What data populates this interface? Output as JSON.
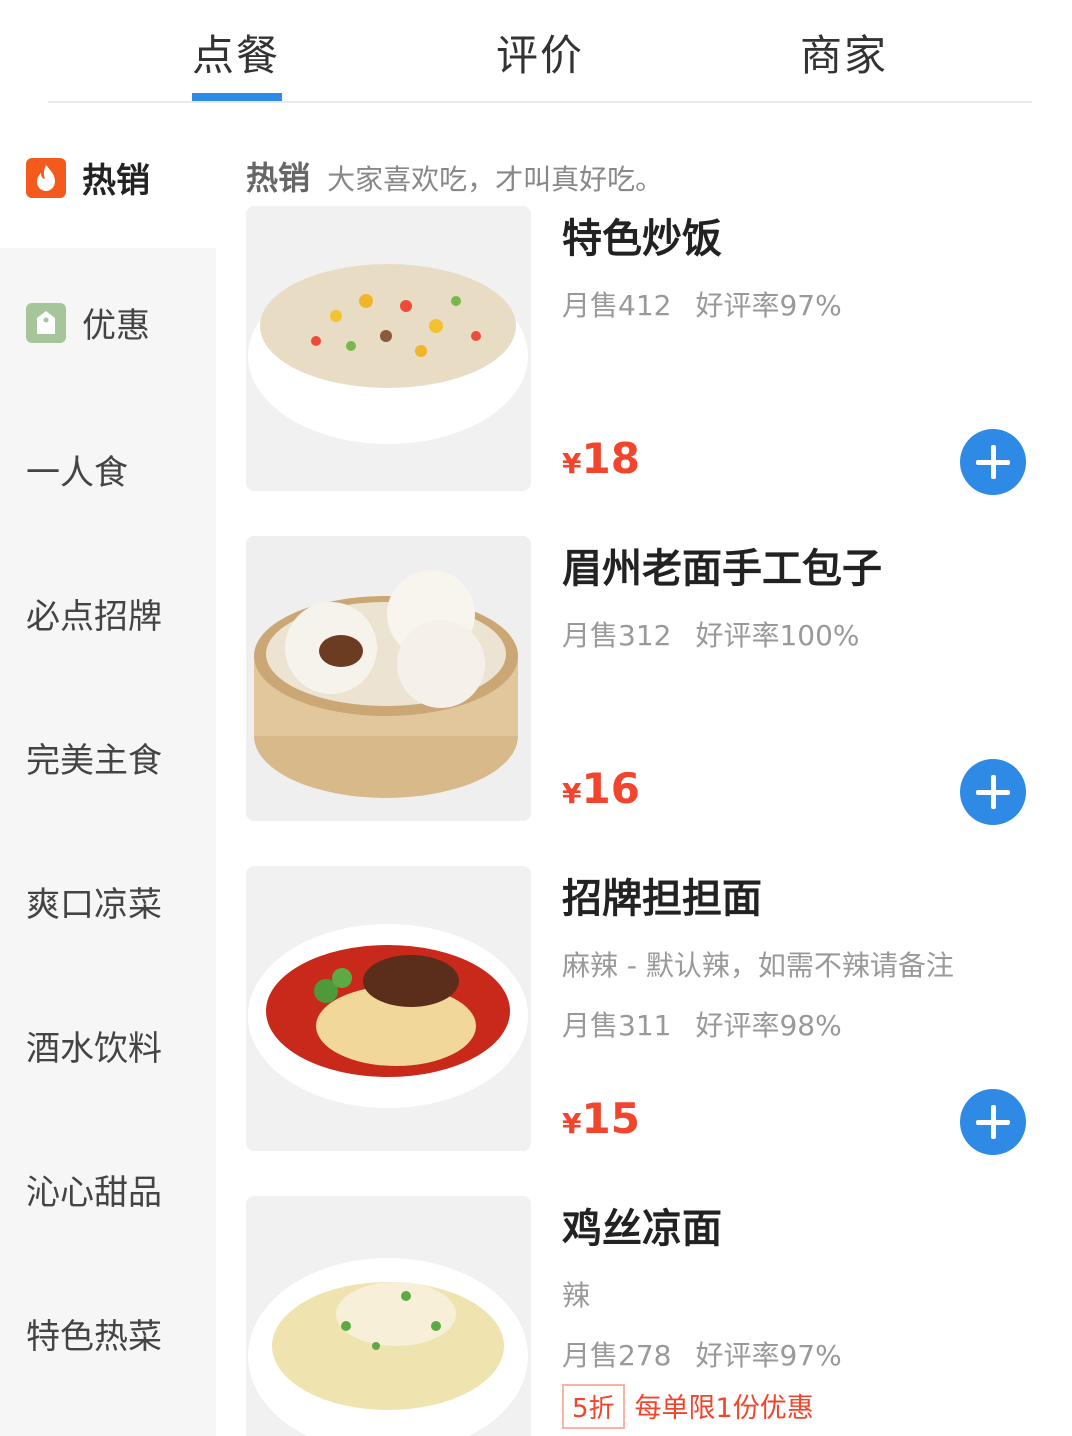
{
  "tabs": [
    {
      "label": "点餐"
    },
    {
      "label": "评价"
    },
    {
      "label": "商家"
    }
  ],
  "active_tab": "点餐",
  "accent_color": "#2f8ae6",
  "price_color": "#f1452d",
  "sidebar": {
    "items": [
      {
        "label": "热销",
        "icon": "fire-icon"
      },
      {
        "label": "优惠",
        "icon": "tag-icon"
      },
      {
        "label": "一人食"
      },
      {
        "label": "必点招牌"
      },
      {
        "label": "完美主食"
      },
      {
        "label": "爽口凉菜"
      },
      {
        "label": "酒水饮料"
      },
      {
        "label": "沁心甜品"
      },
      {
        "label": "特色热菜"
      }
    ]
  },
  "section": {
    "title": "热销",
    "subtitle": "大家喜欢吃，才叫真好吃。"
  },
  "products": [
    {
      "name": "特色炒饭",
      "monthly_sales": "月售412",
      "rating": "好评率97%",
      "currency": "¥",
      "price": "18"
    },
    {
      "name": "眉州老面手工包子",
      "monthly_sales": "月售312",
      "rating": "好评率100%",
      "currency": "¥",
      "price": "16"
    },
    {
      "name": "招牌担担面",
      "desc": "麻辣 - 默认辣，如需不辣请备注",
      "monthly_sales": "月售311",
      "rating": "好评率98%",
      "currency": "¥",
      "price": "15"
    },
    {
      "name": "鸡丝凉面",
      "desc": "辣",
      "monthly_sales": "月售278",
      "rating": "好评率97%",
      "promo_badge": "5折",
      "promo_text": "每单限1份优惠"
    }
  ]
}
